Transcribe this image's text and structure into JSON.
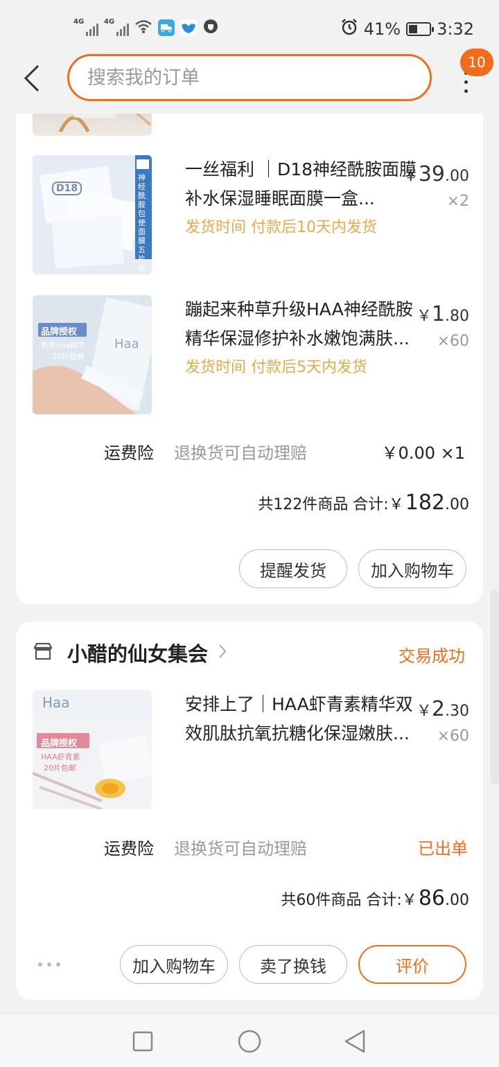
{
  "status_bar": {
    "signal1": "4G",
    "signal2": "4G",
    "battery_percent": "41%",
    "battery_level": 0.41,
    "time": "3:32",
    "icons": [
      "signal-icon",
      "signal-icon",
      "wifi-icon",
      "delivery-app-icon",
      "bird-app-icon",
      "shield-app-icon",
      "alarm-icon",
      "battery-icon"
    ]
  },
  "header": {
    "search_placeholder": "搜索我的订单",
    "badge_count": "10",
    "accent_color": "#f26b1d"
  },
  "order1": {
    "items": [
      {
        "title": "一丝福利 ｜D18神经酰胺面膜补水保湿睡眠面膜一盒...",
        "ship_time": "发货时间 付款后10天内发货",
        "price_yen": "￥",
        "price_int": "39",
        "price_dec": ".00",
        "qty": "×2",
        "thumb_label": "D18",
        "thumb_side": "神经酰胺包使面膜五片装"
      },
      {
        "title": "蹦起来种草升级HAA神经酰胺精华保湿修护补水嫩饱满肤...",
        "ship_time": "发货时间 付款后5天内发货",
        "price_yen": "￥",
        "price_int": "1",
        "price_dec": ".80",
        "qty": "×60",
        "thumb_label": "品牌授权",
        "thumb_sub1": "新款haa精华",
        "thumb_sub2": "20片包邮",
        "thumb_logo": "Haa"
      }
    ],
    "insurance_label": "运费险",
    "insurance_desc": "退换货可自动理赔",
    "insurance_price": "￥0.00 ×1",
    "total_prefix": "共122件商品 合计:",
    "total_yen": "￥",
    "total_int": "182",
    "total_dec": ".00",
    "buttons": [
      "提醒发货",
      "加入购物车"
    ]
  },
  "order2": {
    "shop_name": "小醋的仙女集会",
    "status": "交易成功",
    "items": [
      {
        "title": "安排上了｜HAA虾青素精华双效肌肽抗氧抗糖化保湿嫩肤...",
        "price_yen": "￥",
        "price_int": "2",
        "price_dec": ".30",
        "qty": "×60",
        "thumb_label": "品牌授权",
        "thumb_sub1": "HAA虾青素",
        "thumb_sub2": "20片包邮",
        "thumb_logo": "Haa"
      }
    ],
    "insurance_label": "运费险",
    "insurance_desc": "退换货可自动理赔",
    "insurance_status": "已出单",
    "total_prefix": "共60件商品 合计:",
    "total_yen": "￥",
    "total_int": "86",
    "total_dec": ".00",
    "buttons": [
      "加入购物车",
      "卖了换钱",
      "评价"
    ]
  },
  "nav": {
    "icons": [
      "recent-apps-icon",
      "home-icon",
      "back-triangle-icon"
    ]
  }
}
